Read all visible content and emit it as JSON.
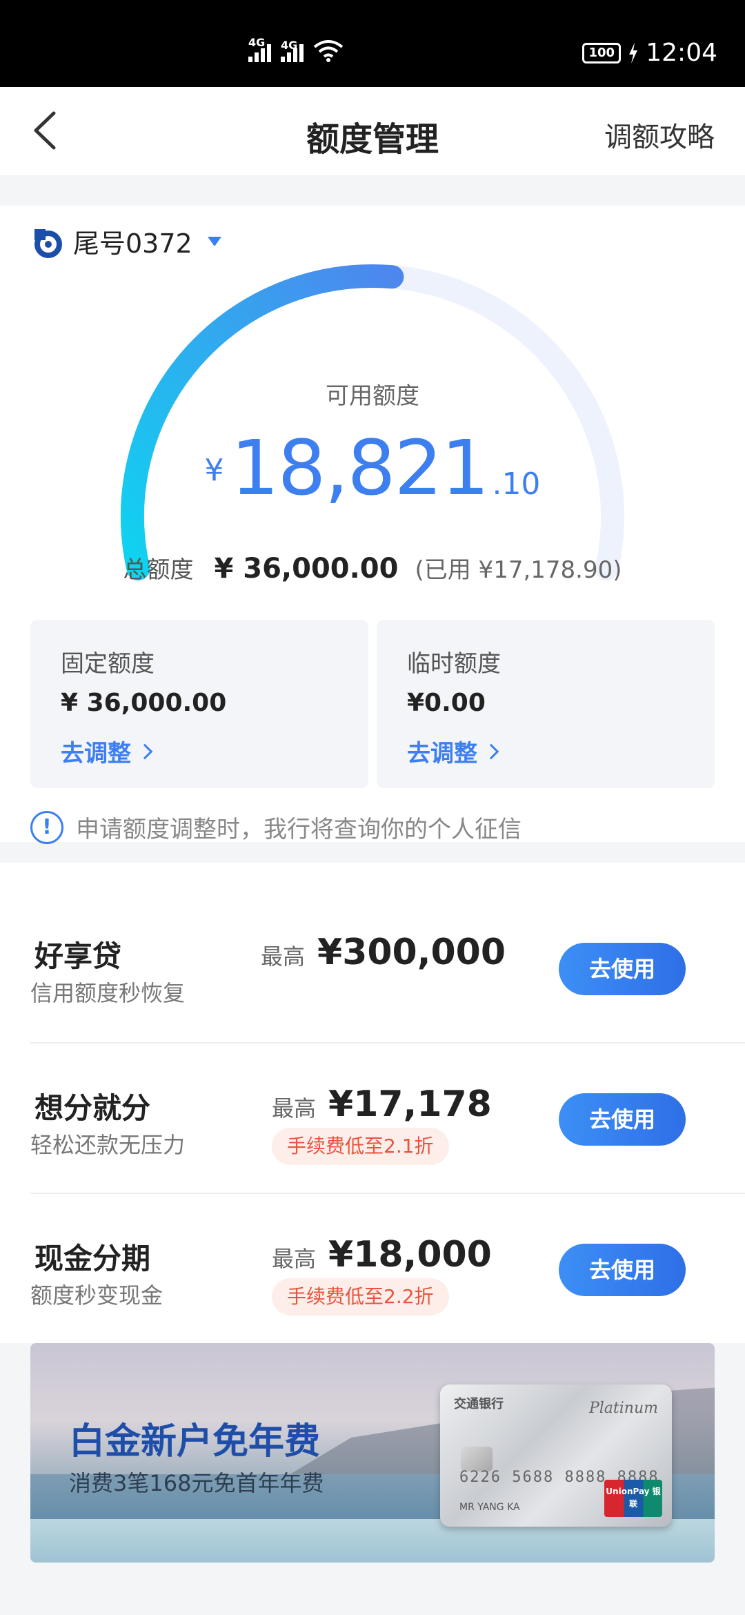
{
  "status_bar": {
    "signal1_label": "4G",
    "signal2_label": "4G",
    "battery": "100",
    "time": "12:04"
  },
  "nav": {
    "back_icon": "chevron-left-icon",
    "title": "额度管理",
    "right_link": "调额攻略"
  },
  "card": {
    "tail_label": "尾号0372",
    "available_label": "可用额度",
    "available_currency": "¥",
    "available_int": "18,821",
    "available_dec": ".10",
    "available_fraction": 0.5228,
    "total_label": "总额度",
    "total_value": "¥ 36,000.00",
    "used_text": "(已用 ¥17,178.90)"
  },
  "quota": {
    "fixed": {
      "title": "固定额度",
      "value": "¥ 36,000.00",
      "link": "去调整"
    },
    "temp": {
      "title": "临时额度",
      "value": "¥0.00",
      "link": "去调整"
    }
  },
  "notice": {
    "icon": "info-circle-icon",
    "text": "申请额度调整时，我行将查询你的个人征信"
  },
  "products": [
    {
      "name": "好享贷",
      "sub": "信用额度秒恢复",
      "max_label": "最高",
      "amount": "¥300,000",
      "tag": "",
      "button": "去使用"
    },
    {
      "name": "想分就分",
      "sub": "轻松还款无压力",
      "max_label": "最高",
      "amount": "¥17,178",
      "tag": "手续费低至2.1折",
      "button": "去使用"
    },
    {
      "name": "现金分期",
      "sub": "额度秒变现金",
      "max_label": "最高",
      "amount": "¥18,000",
      "tag": "手续费低至2.2折",
      "button": "去使用"
    }
  ],
  "banner": {
    "title": "白金新户免年费",
    "subtitle": "消费3笔168元免首年年费",
    "card_bank": "交通银行",
    "card_tier": "Platinum",
    "card_number": "6226 5688 8888 8888",
    "card_holder": "MR YANG KA",
    "card_network": "UnionPay 银联"
  },
  "colors": {
    "accent": "#3d7ff0",
    "gauge_start": "#0fd3f0",
    "gauge_end": "#4d87ee",
    "gauge_track": "#eef2fc",
    "tag_text": "#e9533d",
    "tag_bg": "#fdeeea"
  }
}
